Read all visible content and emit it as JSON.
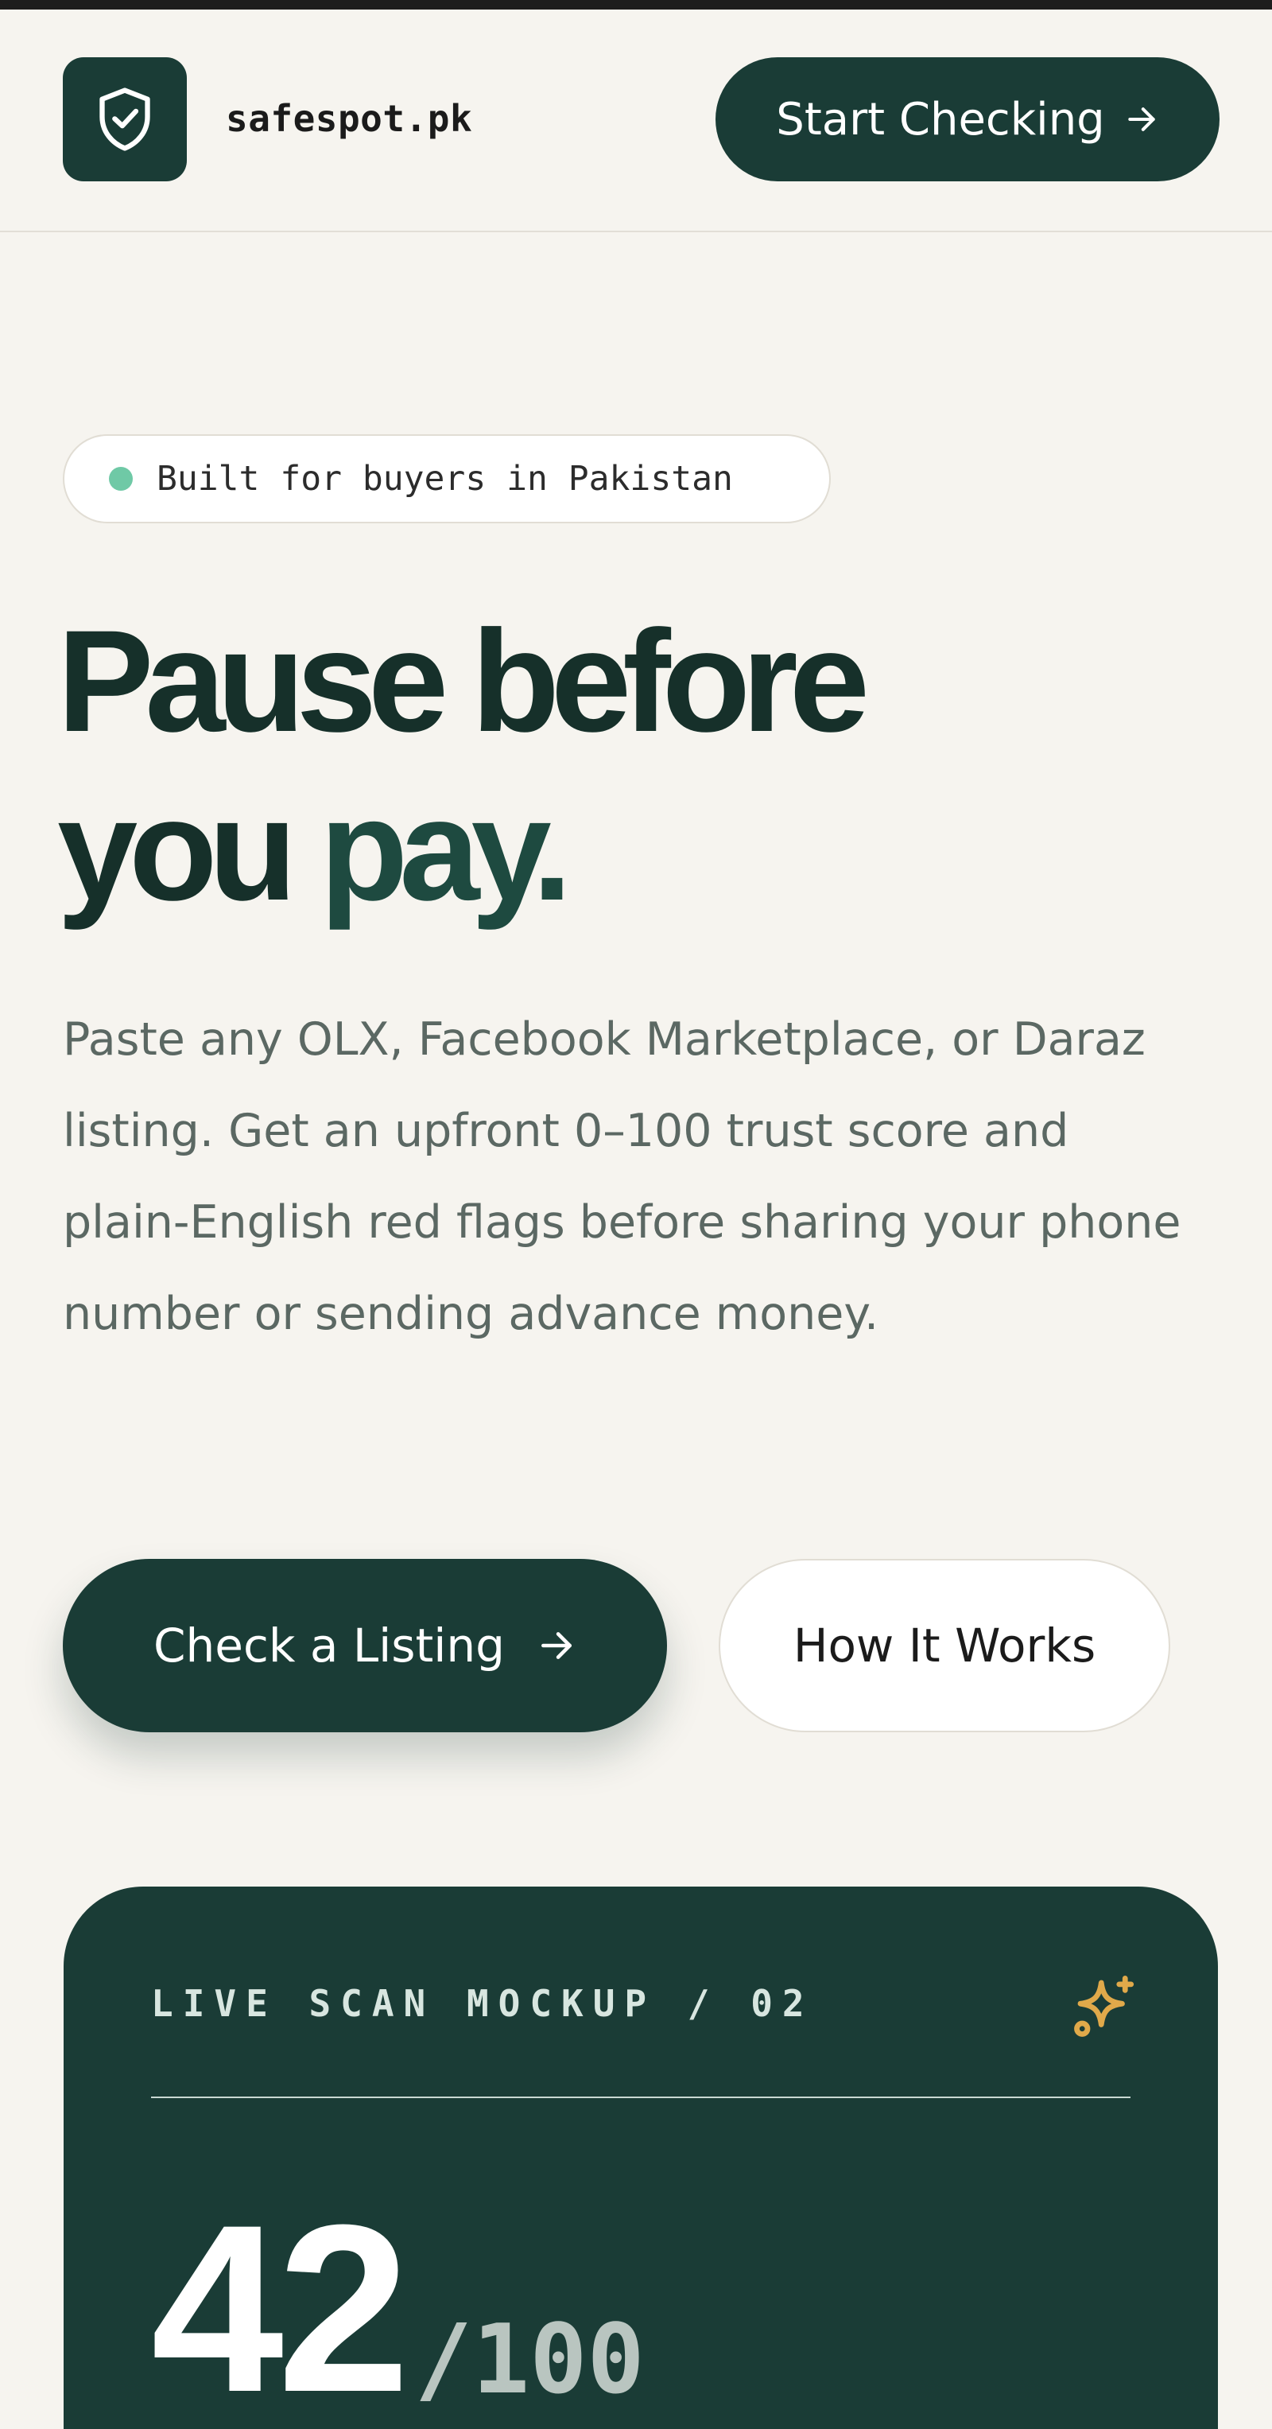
{
  "header": {
    "brand": "safespot.pk",
    "start_button_label": "Start Checking",
    "logo_icon": "shield-check-icon"
  },
  "hero": {
    "badge_text": "Built for buyers in Pakistan",
    "headline_line1": "Pause before",
    "headline_line2_part1": "you ",
    "headline_line2_accent": "pay.",
    "lead": "Paste any OLX, Facebook Marketplace, or Daraz listing. Get an upfront 0–100 trust score and plain-English red flags before sharing your phone number or sending advance money.",
    "primary_cta": "Check a Listing",
    "secondary_cta": "How It Works"
  },
  "scan_card": {
    "label": "LIVE SCAN MOCKUP / 02",
    "score": "42",
    "score_max": "/100",
    "sparkle_icon": "sparkle-icon"
  },
  "colors": {
    "brand_dark": "#1a3c36",
    "background": "#f6f4ef",
    "badge_dot": "#6fc9a6",
    "sparkle": "#e0a94a"
  }
}
